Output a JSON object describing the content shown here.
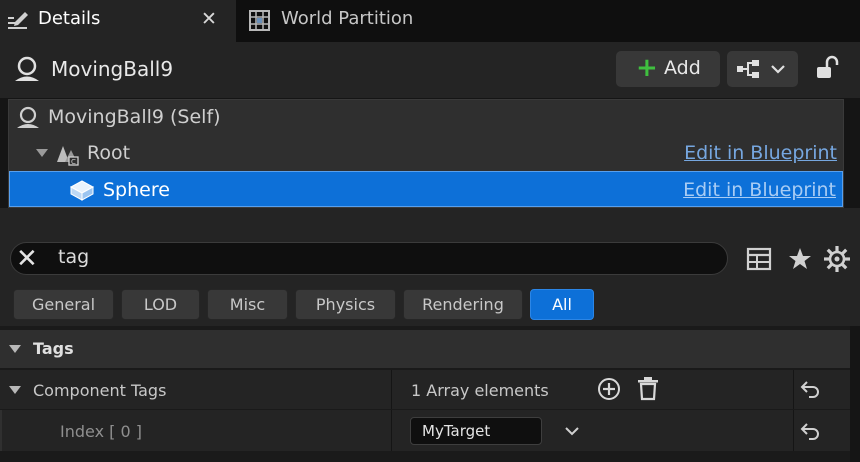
{
  "tabs": [
    {
      "label": "Details"
    },
    {
      "label": "World Partition"
    }
  ],
  "tab_close_glyph": "✕",
  "header": {
    "actor_name": "MovingBall9",
    "add_label": "Add"
  },
  "tree": {
    "items": [
      {
        "label": "MovingBall9 (Self)",
        "link": ""
      },
      {
        "label": "Root",
        "link": "Edit in Blueprint"
      },
      {
        "label": "Sphere",
        "link": "Edit in Blueprint"
      }
    ]
  },
  "search": {
    "value": "tag",
    "placeholder": "Search"
  },
  "filters": [
    "General",
    "LOD",
    "Misc",
    "Physics",
    "Rendering",
    "All"
  ],
  "active_filter": "All",
  "properties": {
    "category": "Tags",
    "component_tags_label": "Component Tags",
    "array_summary": "1 Array elements",
    "index_label": "Index [ 0 ]",
    "index_value": "MyTarget"
  },
  "colors": {
    "accent": "#0d70d8",
    "add_green": "#3fbf3f",
    "link": "#76a7e0"
  },
  "icons": {
    "details": "pencil-grid-icon",
    "world_partition": "grid-map-icon",
    "actor": "actor-sphere-icon",
    "add": "plus-icon",
    "blueprint": "blueprint-hierarchy-icon",
    "lock": "unlocked-padlock-icon",
    "scene_root": "scene-component-icon",
    "sphere": "static-mesh-icon",
    "grid_view": "table-icon",
    "favorites": "star-icon",
    "settings": "gear-icon",
    "add_element": "circle-plus-icon",
    "empty_array": "trash-icon",
    "reset": "reset-arrow-icon"
  }
}
